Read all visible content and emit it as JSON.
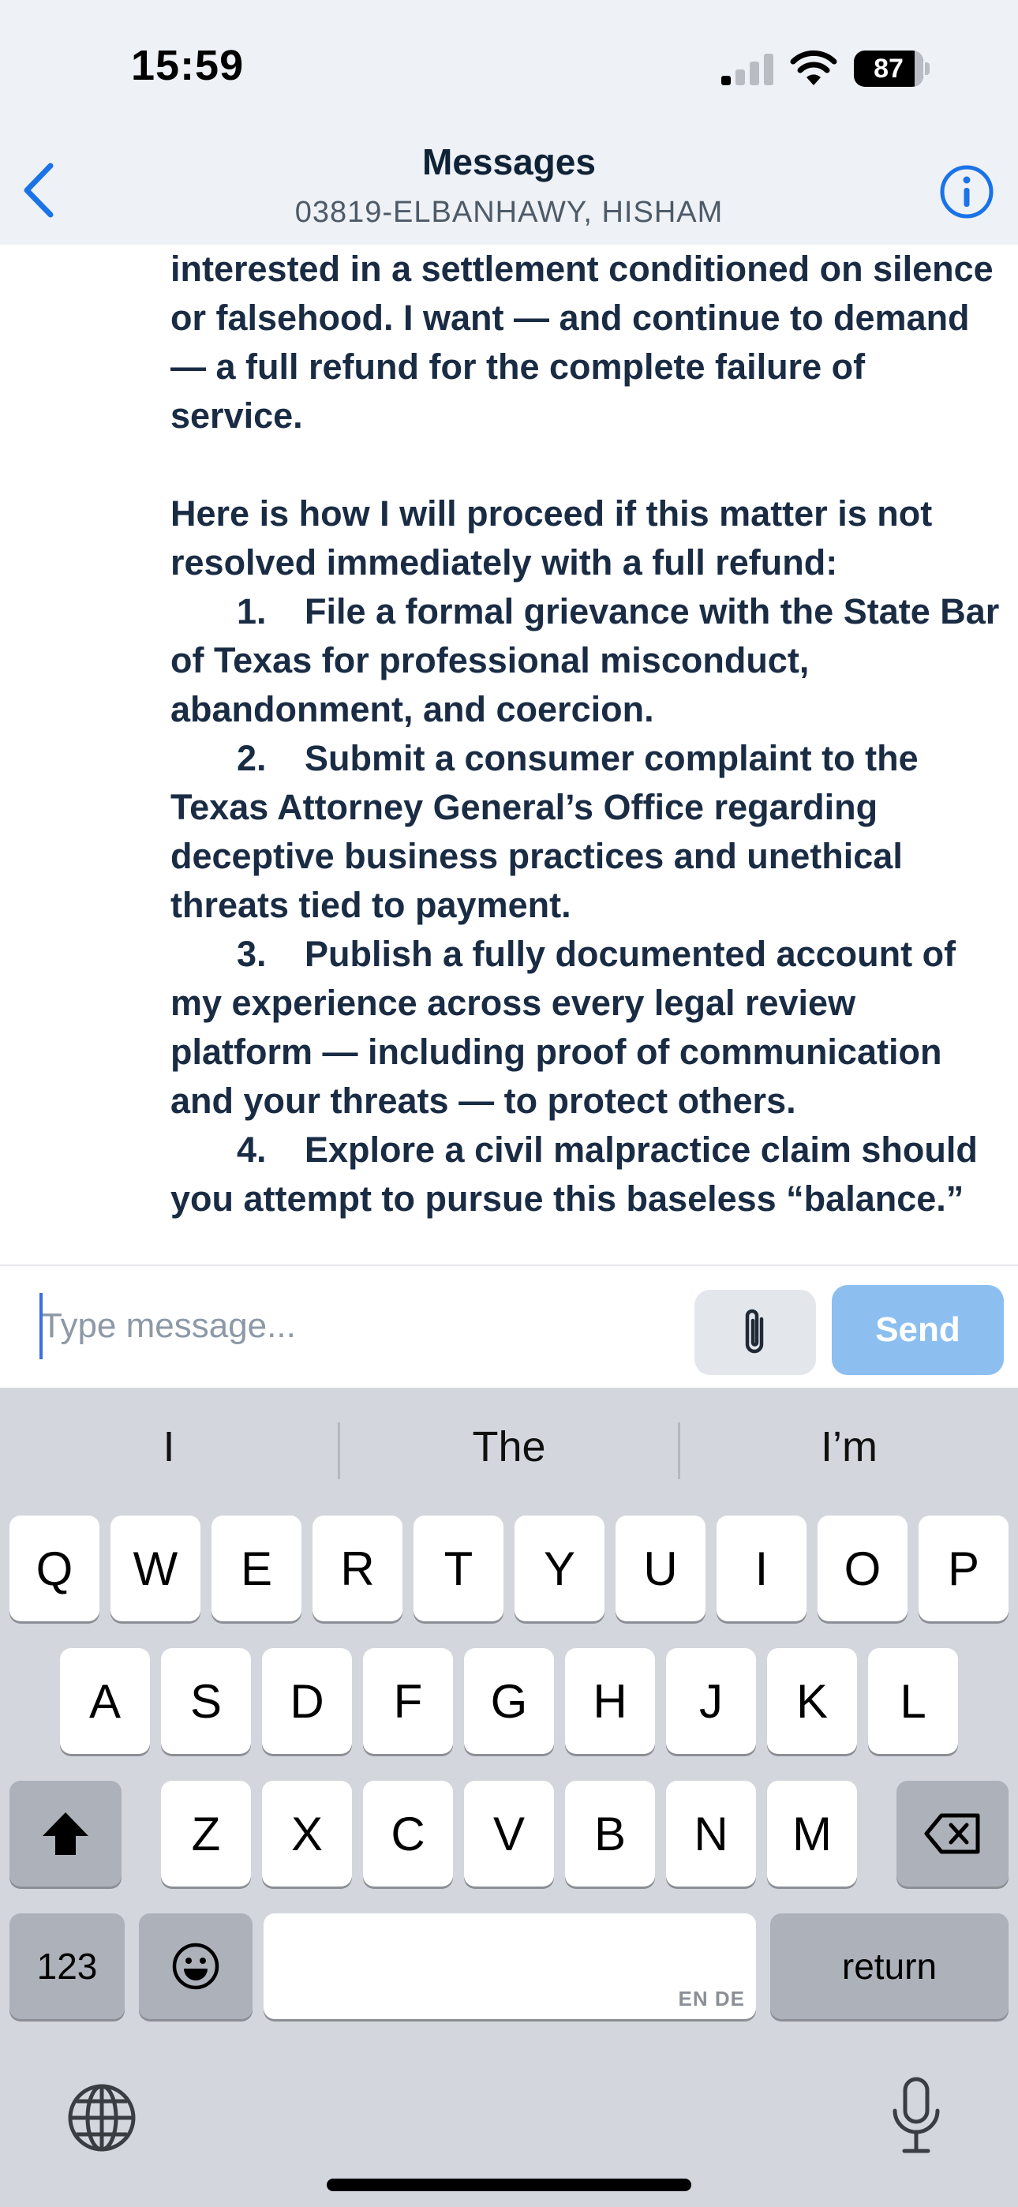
{
  "status_bar": {
    "time": "15:59",
    "battery_level": "87"
  },
  "header": {
    "title": "Messages",
    "subtitle": "03819-ELBANHAWY, HISHAM"
  },
  "message": {
    "paragraph_1": "interested in a settlement conditioned on silence or falsehood. I want — and continue to demand — a full refund for the complete failure of service.",
    "paragraph_2": "Here is how I will proceed if this matter is not resolved immediately with a full refund:",
    "list": [
      {
        "num": "1.",
        "text": "File a formal grievance with the State Bar of Texas for professional misconduct, abandonment, and coercion."
      },
      {
        "num": "2.",
        "text": "Submit a consumer complaint to the Texas Attorney General’s Office regarding deceptive business practices and unethical threats tied to payment."
      },
      {
        "num": "3.",
        "text": "Publish a fully documented account of my experience across every legal review platform — including proof of communication and your threats — to protect others."
      },
      {
        "num": "4.",
        "text": "Explore a civil malpractice claim should you attempt to pursue this baseless “balance.”"
      }
    ]
  },
  "composer": {
    "placeholder": "Type message...",
    "send_label": "Send"
  },
  "keyboard": {
    "suggestions": [
      "I",
      "The",
      "I’m"
    ],
    "row1": [
      "Q",
      "W",
      "E",
      "R",
      "T",
      "Y",
      "U",
      "I",
      "O",
      "P"
    ],
    "row2": [
      "A",
      "S",
      "D",
      "F",
      "G",
      "H",
      "J",
      "K",
      "L"
    ],
    "row3": [
      "Z",
      "X",
      "C",
      "V",
      "B",
      "N",
      "M"
    ],
    "numbers_label": "123",
    "return_label": "return",
    "space_languages": "EN DE"
  },
  "colors": {
    "accent": "#1a73e8",
    "send_button": "#8cbff0",
    "header_bg": "#eef1f5",
    "keyboard_bg": "#d3d6dd"
  }
}
